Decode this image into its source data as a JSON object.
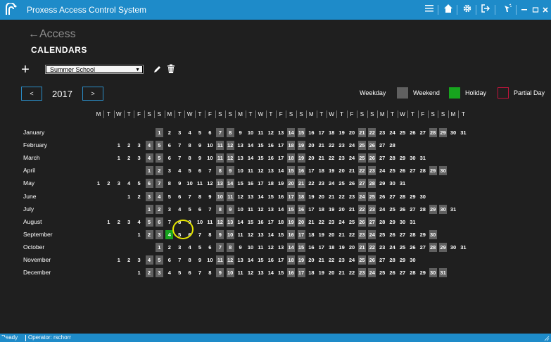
{
  "window": {
    "title": "Proxess Access Control System",
    "icons": [
      "menu-icon",
      "home-icon",
      "gear-icon",
      "logout-icon",
      "feedback-icon",
      "minimize-icon",
      "maximize-icon",
      "close-icon"
    ]
  },
  "nav": {
    "back_label": "Access",
    "page_title": "CALENDARS"
  },
  "toolbar": {
    "add_label": "+",
    "selected_calendar": "Summer School"
  },
  "year_nav": {
    "prev_label": "<",
    "year": "2017",
    "next_label": ">"
  },
  "legend": [
    {
      "label": "Weekday",
      "color": "#1f1f1f",
      "border": "#1f1f1f"
    },
    {
      "label": "Weekend",
      "color": "#606060",
      "border": "#606060"
    },
    {
      "label": "Holiday",
      "color": "#17a41e",
      "border": "#17a41e"
    },
    {
      "label": "Partial Day",
      "color": "#1f1f1f",
      "border": "#c0143c"
    }
  ],
  "weekday_headers": [
    "M",
    "T",
    "W",
    "T",
    "F",
    "S",
    "S",
    "M",
    "T",
    "W",
    "T",
    "F",
    "S",
    "S",
    "M",
    "T",
    "W",
    "T",
    "F",
    "S",
    "S",
    "M",
    "T",
    "W",
    "T",
    "F",
    "S",
    "S",
    "M",
    "T",
    "W",
    "T",
    "F",
    "S",
    "S",
    "M",
    "T"
  ],
  "months": [
    {
      "name": "January",
      "offset": 6,
      "days": 31,
      "holidays": []
    },
    {
      "name": "February",
      "offset": 2,
      "days": 28,
      "holidays": []
    },
    {
      "name": "March",
      "offset": 2,
      "days": 31,
      "holidays": []
    },
    {
      "name": "April",
      "offset": 5,
      "days": 30,
      "holidays": []
    },
    {
      "name": "May",
      "offset": 0,
      "days": 31,
      "holidays": []
    },
    {
      "name": "June",
      "offset": 3,
      "days": 30,
      "holidays": []
    },
    {
      "name": "July",
      "offset": 5,
      "days": 31,
      "holidays": []
    },
    {
      "name": "August",
      "offset": 1,
      "days": 31,
      "holidays": []
    },
    {
      "name": "September",
      "offset": 4,
      "days": 30,
      "holidays": [
        4
      ]
    },
    {
      "name": "October",
      "offset": 6,
      "days": 31,
      "holidays": []
    },
    {
      "name": "November",
      "offset": 2,
      "days": 30,
      "holidays": []
    },
    {
      "name": "December",
      "offset": 4,
      "days": 31,
      "holidays": []
    }
  ],
  "status": {
    "state": "Ready",
    "operator": "Operator: rschorr"
  }
}
